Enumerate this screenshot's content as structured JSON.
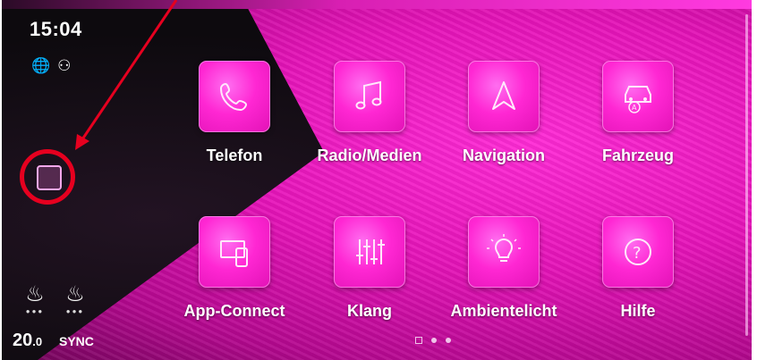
{
  "status": {
    "time": "15:04",
    "icons": [
      "globe-icon",
      "driver-profile-icon"
    ]
  },
  "sidebar": {
    "temperature_main": "20",
    "temperature_decimal": ".0",
    "sync_label": "SYNC",
    "seat_icons": [
      "seat-heating-left-icon",
      "seat-heating-right-icon"
    ]
  },
  "apps": [
    {
      "label": "Telefon",
      "icon": "phone-icon"
    },
    {
      "label": "Radio/Medien",
      "icon": "music-note-icon"
    },
    {
      "label": "Navigation",
      "icon": "navigation-arrow-icon"
    },
    {
      "label": "Fahrzeug",
      "icon": "car-icon"
    },
    {
      "label": "App-Connect",
      "icon": "app-connect-icon"
    },
    {
      "label": "Klang",
      "icon": "equalizer-icon"
    },
    {
      "label": "Ambientelicht",
      "icon": "light-bulb-icon"
    },
    {
      "label": "Hilfe",
      "icon": "help-icon"
    }
  ],
  "pager": {
    "current": 1,
    "total": 3
  },
  "colors": {
    "accent": "#ff27d3",
    "annotation": "#e6001f"
  }
}
